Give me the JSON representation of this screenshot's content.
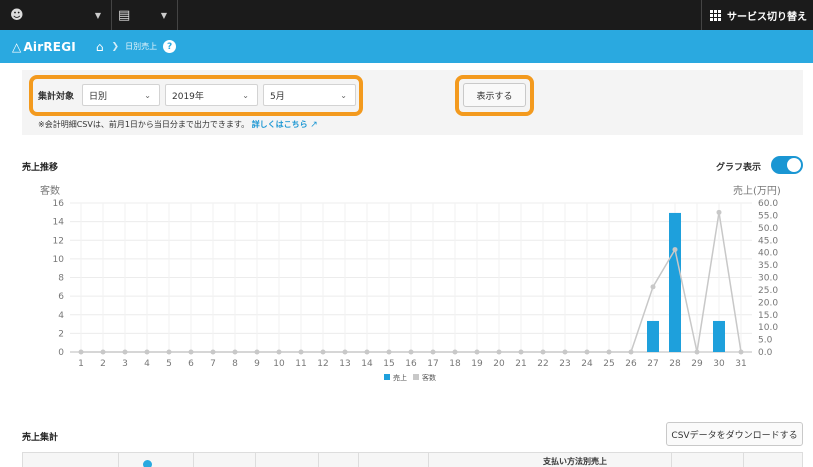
{
  "topbar": {
    "user_icon": "person-icon",
    "store_icon": "store-icon",
    "service_switch": "サービス切り替え"
  },
  "appbar": {
    "logo": "AirREGI",
    "breadcrumb": "日別売上",
    "help": "?"
  },
  "filter": {
    "label": "集計対象",
    "period_type": "日別",
    "year": "2019年",
    "month": "5月",
    "show_button": "表示する",
    "note": "※会計明細CSVは、前月1日から当日分まで出力できます。",
    "note_link": "詳しくはこちら"
  },
  "sales_trend": {
    "title": "売上推移",
    "graph_toggle_label": "グラフ表示",
    "graph_toggle_on": true
  },
  "chart_data": {
    "type": "bar",
    "left_axis_label": "客数",
    "right_axis_label": "売上(万円)",
    "left_ylim": [
      0,
      16
    ],
    "right_ylim": [
      0,
      60
    ],
    "left_ticks": [
      "0",
      "2",
      "4",
      "6",
      "8",
      "10",
      "12",
      "14",
      "16"
    ],
    "right_ticks": [
      "0.0",
      "5.0",
      "10.0",
      "15.0",
      "20.0",
      "25.0",
      "30.0",
      "35.0",
      "40.0",
      "45.0",
      "50.0",
      "55.0",
      "60.0"
    ],
    "categories": [
      "1",
      "2",
      "3",
      "4",
      "5",
      "6",
      "7",
      "8",
      "9",
      "10",
      "11",
      "12",
      "13",
      "14",
      "15",
      "16",
      "17",
      "18",
      "19",
      "20",
      "21",
      "22",
      "23",
      "24",
      "25",
      "26",
      "27",
      "28",
      "29",
      "30",
      "31"
    ],
    "series": [
      {
        "name": "売上",
        "axis": "right",
        "kind": "bar",
        "color": "#1ea0dc",
        "values": [
          0,
          0,
          0,
          0,
          0,
          0,
          0,
          0,
          0,
          0,
          0,
          0,
          0,
          0,
          0,
          0,
          0,
          0,
          0,
          0,
          0,
          0,
          0,
          0,
          0,
          0,
          12.5,
          56,
          0,
          12.5,
          0
        ]
      },
      {
        "name": "客数",
        "axis": "left",
        "kind": "line",
        "color": "#c8c8c8",
        "values": [
          0,
          0,
          0,
          0,
          0,
          0,
          0,
          0,
          0,
          0,
          0,
          0,
          0,
          0,
          0,
          0,
          0,
          0,
          0,
          0,
          0,
          0,
          0,
          0,
          0,
          0,
          7,
          11,
          0,
          15,
          0
        ]
      }
    ],
    "legend": [
      "売上",
      "客数"
    ],
    "legend_position": "bottom-center",
    "grid": true
  },
  "sales_summary": {
    "title": "売上集計",
    "csv_button": "CSVデータをダウンロードする",
    "header_payment": "支払い方法別売上"
  }
}
